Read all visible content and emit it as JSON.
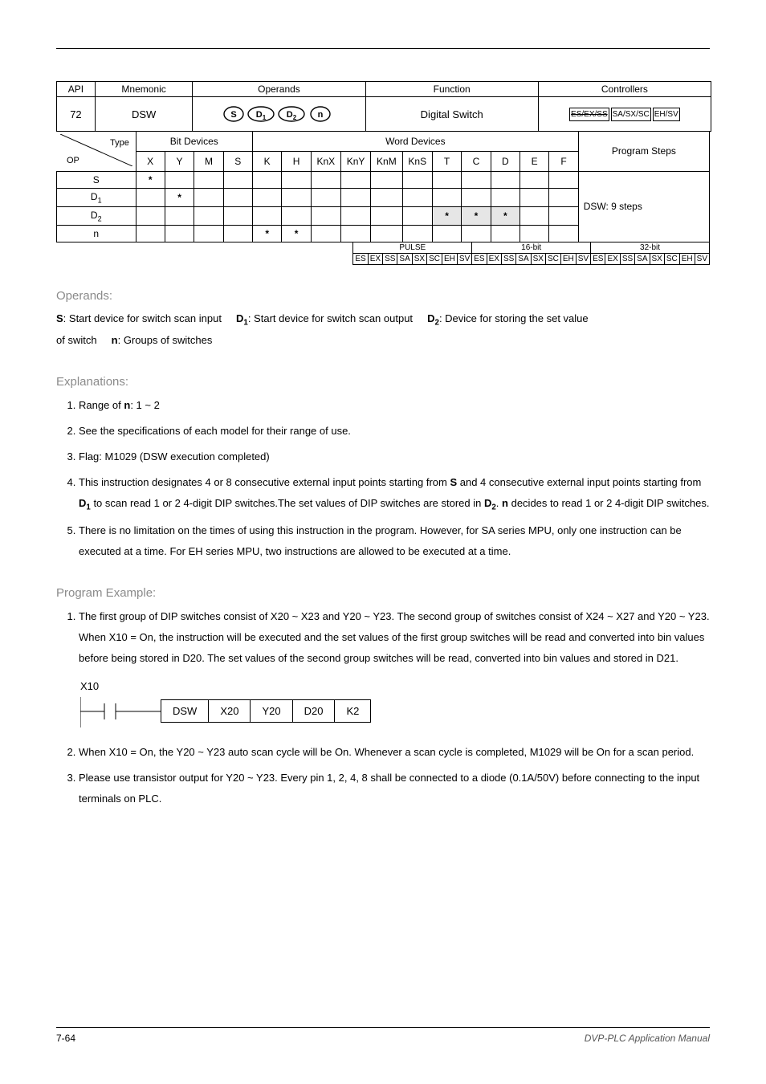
{
  "api": {
    "header_api": "API",
    "header_mnemonic": "Mnemonic",
    "header_operands": "Operands",
    "header_function": "Function",
    "header_controllers": "Controllers",
    "number": "72",
    "mnemonic": "DSW",
    "function": "Digital Switch",
    "controllers": [
      "ES/EX/SS",
      "SA/SX/SC",
      "EH/SV"
    ]
  },
  "optable": {
    "type_label": "Type",
    "op_label": "OP",
    "bit_header": "Bit Devices",
    "word_header": "Word Devices",
    "steps_header": "Program Steps",
    "cols_bit": [
      "X",
      "Y",
      "M",
      "S"
    ],
    "cols_word": [
      "K",
      "H",
      "KnX",
      "KnY",
      "KnM",
      "KnS",
      "T",
      "C",
      "D",
      "E",
      "F"
    ],
    "steps_text": "DSW: 9 steps",
    "rows": [
      {
        "label": "S",
        "marks": {
          "X": true
        },
        "shade": []
      },
      {
        "label": "D1",
        "sub": "1",
        "marks": {
          "Y": true
        },
        "shade": []
      },
      {
        "label": "D2",
        "sub": "2",
        "marks": {
          "T": true,
          "C": true,
          "D": true
        },
        "shade": [
          "T",
          "C",
          "D"
        ]
      },
      {
        "label": "n",
        "marks": {
          "K": true,
          "H": true
        },
        "shade": []
      }
    ]
  },
  "pb": {
    "headers": [
      "PULSE",
      "16-bit",
      "32-bit"
    ],
    "cells": [
      "ES",
      "EX",
      "SS",
      "SA",
      "SX",
      "SC",
      "EH",
      "SV",
      "ES",
      "EX",
      "SS",
      "SA",
      "SX",
      "SC",
      "EH",
      "SV",
      "ES",
      "EX",
      "SS",
      "SA",
      "SX",
      "SC",
      "EH",
      "SV"
    ]
  },
  "operands_section": {
    "title": "Operands:",
    "s": "S",
    "s_text": ": Start device for switch scan input",
    "d1": "D1",
    "d1_text": ": Start device for switch scan output",
    "d2": "D2",
    "d2_text": ": Device for storing the set value",
    "of_switch": "of switch",
    "n": "n",
    "n_text": ": Groups of switches"
  },
  "explanations": {
    "title": "Explanations:",
    "items": [
      "Range of n: 1 ~ 2",
      "See the specifications of each model for their range of use.",
      "Flag: M1029 (DSW execution completed)",
      "This instruction designates 4 or 8 consecutive external input points starting from S and 4 consecutive external input points starting from D1 to scan read 1 or 2 4-digit DIP switches.The set values of DIP switches are stored in D2. n decides to read 1 or 2 4-digit DIP switches.",
      "There is no limitation on the times of using this instruction in the program. However, for SA series MPU, only one instruction can be executed at a time. For EH series MPU, two instructions are allowed to be executed at a time."
    ]
  },
  "example": {
    "title": "Program Example:",
    "item1": "The first group of DIP switches consist of X20 ~ X23 and Y20 ~ Y23. The second group of switches consist of X24 ~ X27 and Y20 ~ Y23. When X10 = On, the instruction will be executed and the set values of the first group switches will be read and converted into bin values before being stored in D20. The set values of the second group switches will be read, converted into bin values and stored in D21.",
    "ladder": {
      "x": "X10",
      "cells": [
        "DSW",
        "X20",
        "Y20",
        "D20",
        "K2"
      ]
    },
    "item2": "When X10 = On, the Y20 ~ Y23 auto scan cycle will be On. Whenever a scan cycle is completed, M1029 will be On for a scan period.",
    "item3": "Please use transistor output for Y20 ~ Y23. Every pin 1, 2, 4, 8 shall be connected to a diode (0.1A/50V) before connecting to the input terminals on PLC."
  },
  "footer": {
    "page": "7-64",
    "right": "DVP-PLC Application Manual"
  }
}
